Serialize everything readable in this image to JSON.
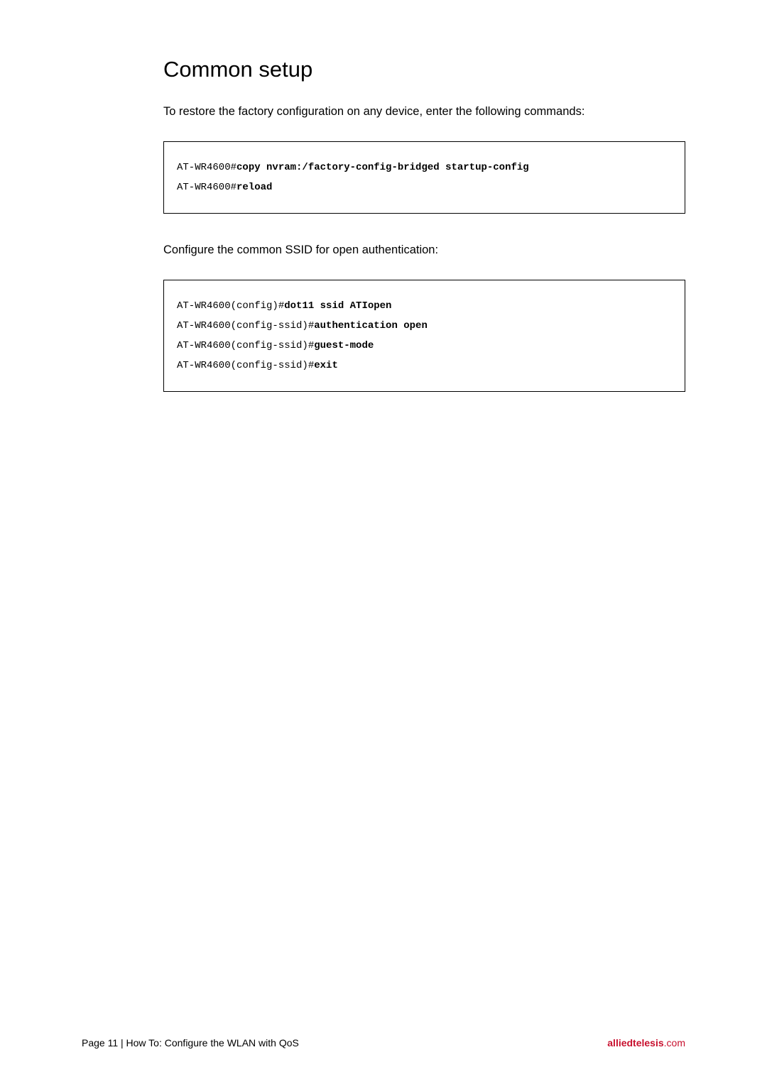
{
  "heading": "Common setup",
  "intro_text": "To restore the factory configuration on any device, enter the following commands:",
  "code_block_1": {
    "lines": [
      {
        "prompt": "AT-WR4600#",
        "command": "copy nvram:/factory-config-bridged startup-config"
      },
      {
        "prompt": "AT-WR4600#",
        "command": "reload"
      }
    ]
  },
  "middle_text": "Configure the common SSID for open authentication:",
  "code_block_2": {
    "lines": [
      {
        "prompt": "AT-WR4600(config)#",
        "command": "dot11 ssid ATIopen"
      },
      {
        "prompt": "AT-WR4600(config-ssid)#",
        "command": "authentication open"
      },
      {
        "prompt": "AT-WR4600(config-ssid)#",
        "command": "guest-mode"
      },
      {
        "prompt": "AT-WR4600(config-ssid)#",
        "command": "exit"
      }
    ]
  },
  "footer": {
    "left": "Page 11 | How To: Configure the WLAN with QoS",
    "brand_bold": "alliedtelesis",
    "brand_suffix": ".com"
  }
}
